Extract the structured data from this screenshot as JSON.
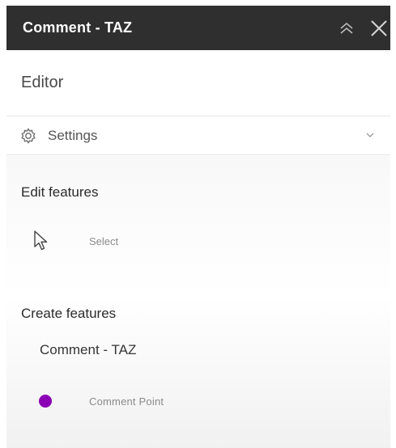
{
  "header": {
    "title": "Comment - TAZ",
    "collapse_icon": "double-chevron-up-icon",
    "close_icon": "close-icon"
  },
  "editor": {
    "title": "Editor"
  },
  "settings": {
    "label": "Settings",
    "icon": "gear-icon",
    "chevron_icon": "chevron-down-icon"
  },
  "edit_features": {
    "heading": "Edit features",
    "tool_label": "Select",
    "tool_icon": "pointer-cursor-icon"
  },
  "create_features": {
    "heading": "Create features",
    "layer_name": "Comment - TAZ",
    "template_label": "Comment  Point",
    "template_symbol_color": "#8b00b5"
  },
  "colors": {
    "header_bg": "#2f2f2f",
    "header_text": "#ffffff",
    "accent_point": "#8b00b5"
  }
}
